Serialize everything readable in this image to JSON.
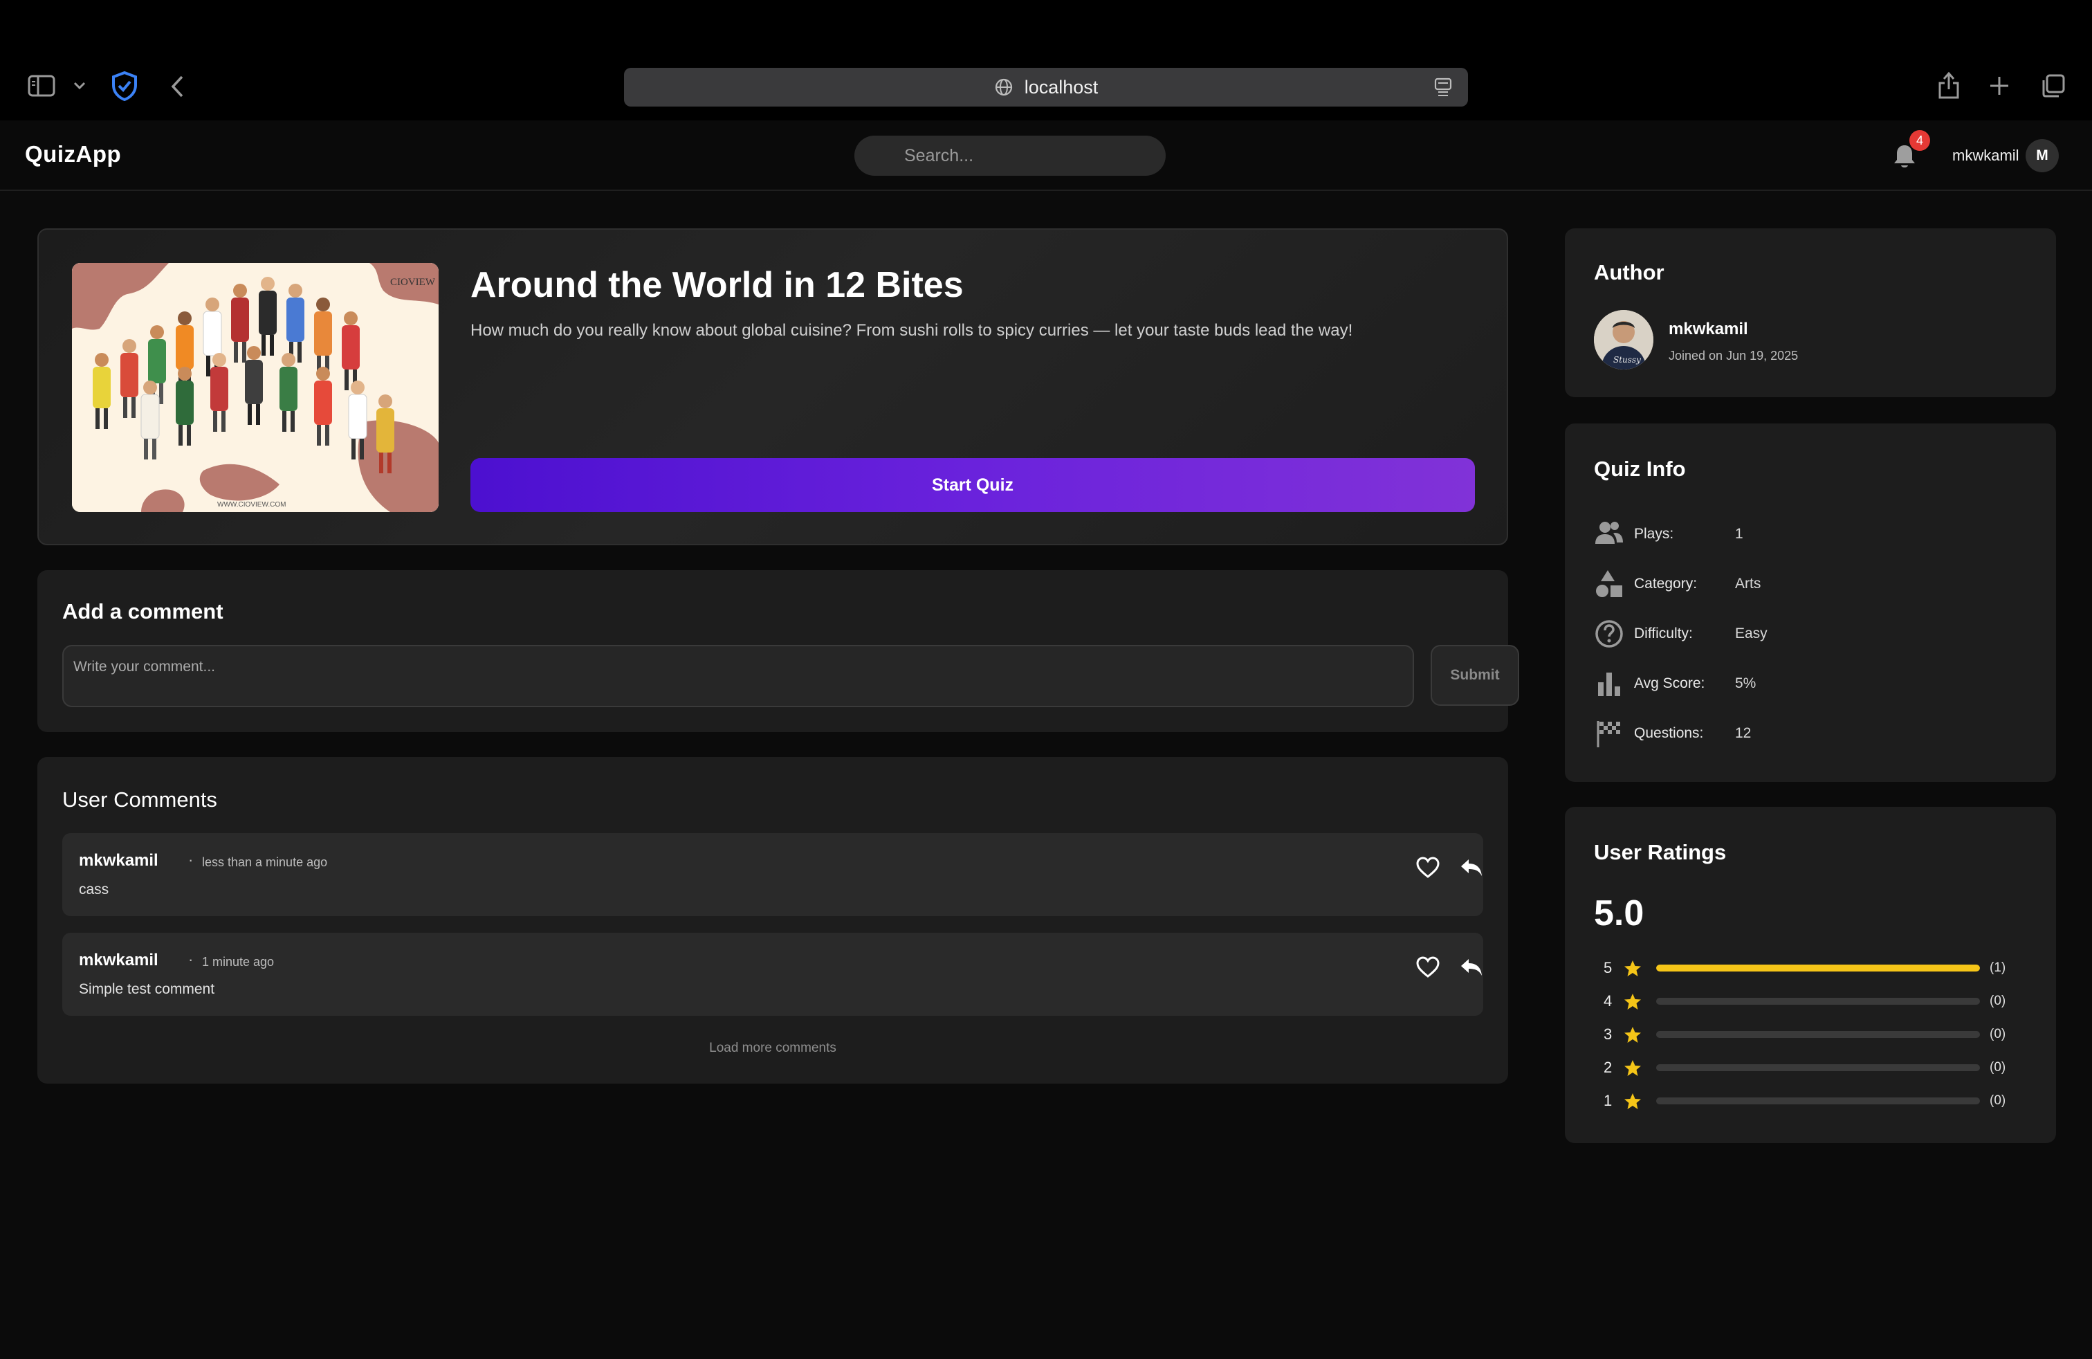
{
  "browser": {
    "url": "localhost"
  },
  "header": {
    "brand": "QuizApp",
    "search_placeholder": "Search...",
    "notification_count": "4",
    "username": "mkwkamil",
    "avatar_initial": "M"
  },
  "quiz": {
    "title": "Around the World in 12 Bites",
    "description": "How much do you really know about global cuisine? From sushi rolls to spicy curries — let your taste buds lead the way!",
    "start_label": "Start Quiz",
    "image_watermark_top": "CIOVIEW",
    "image_watermark_bottom": "WWW.CIOVIEW.COM"
  },
  "add_comment": {
    "title": "Add a comment",
    "placeholder": "Write your comment...",
    "submit_label": "Submit"
  },
  "user_comments": {
    "title": "User Comments",
    "items": [
      {
        "author": "mkwkamil",
        "time": "less than a minute ago",
        "text": "cass"
      },
      {
        "author": "mkwkamil",
        "time": "1 minute ago",
        "text": "Simple test comment"
      }
    ],
    "load_more_label": "Load more comments"
  },
  "author": {
    "title": "Author",
    "name": "mkwkamil",
    "joined": "Joined on Jun 19, 2025"
  },
  "quiz_info": {
    "title": "Quiz Info",
    "rows": [
      {
        "icon": "users-icon",
        "label": "Plays:",
        "value": "1"
      },
      {
        "icon": "category-shapes-icon",
        "label": "Category:",
        "value": "Arts"
      },
      {
        "icon": "question-circle-icon",
        "label": "Difficulty:",
        "value": "Easy"
      },
      {
        "icon": "bar-chart-icon",
        "label": "Avg Score:",
        "value": "5%"
      },
      {
        "icon": "checkered-flag-icon",
        "label": "Questions:",
        "value": "12"
      }
    ]
  },
  "ratings": {
    "title": "User Ratings",
    "average": "5.0",
    "star_color": "#f5c518",
    "rows": [
      {
        "stars": "5",
        "count": "(1)",
        "fraction": 1.0
      },
      {
        "stars": "4",
        "count": "(0)",
        "fraction": 0.0
      },
      {
        "stars": "3",
        "count": "(0)",
        "fraction": 0.0
      },
      {
        "stars": "2",
        "count": "(0)",
        "fraction": 0.0
      },
      {
        "stars": "1",
        "count": "(0)",
        "fraction": 0.0
      }
    ]
  },
  "colors": {
    "accent_gradient_start": "#4c10d0",
    "accent_gradient_end": "#8132d8",
    "badge_red": "#e53935",
    "shield_blue": "#3b82f6"
  }
}
